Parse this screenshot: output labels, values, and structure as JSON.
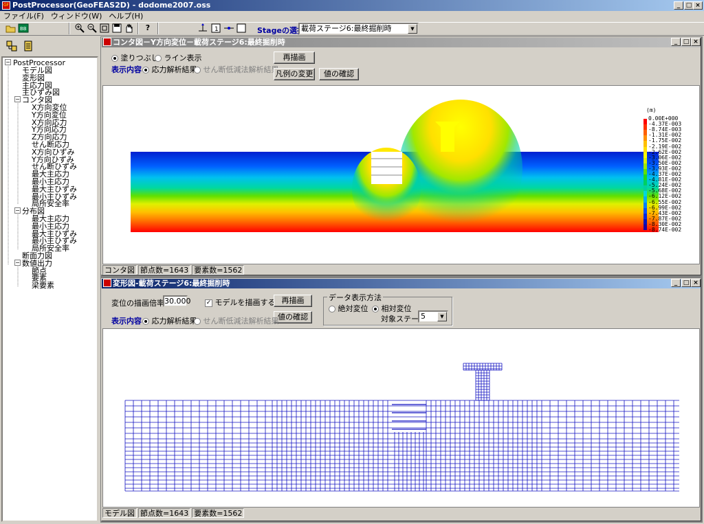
{
  "app": {
    "title": "PostProcessor(GeoFEAS2D) - dodome2007.oss",
    "min": "_",
    "max": "□",
    "close": "×"
  },
  "menu": [
    "ファイル(F)",
    "ウィンドウ(W)",
    "ヘルプ(H)"
  ],
  "toolbar": {
    "icons": [
      "open-icon",
      "export-icon",
      "zoom-in-icon",
      "zoom-out-icon",
      "fit-icon",
      "save-icon",
      "pan-icon",
      "help-icon",
      "axis-icon",
      "frame1-icon",
      "arrow-icon",
      "rect-icon"
    ],
    "help_glyph": "?",
    "stage_label": "Stageの選択",
    "stage_value": "載荷ステージ6:最終掘削時"
  },
  "tree": {
    "root": "PostProcessor",
    "items": [
      {
        "label": "モデル図",
        "level": 1
      },
      {
        "label": "変形図",
        "level": 1
      },
      {
        "label": "主応力図",
        "level": 1
      },
      {
        "label": "主ひずみ図",
        "level": 1
      },
      {
        "label": "コンタ図",
        "level": 1,
        "expanded": true
      },
      {
        "label": "X方向変位",
        "level": 2
      },
      {
        "label": "Y方向変位",
        "level": 2
      },
      {
        "label": "X方向応力",
        "level": 2
      },
      {
        "label": "Y方向応力",
        "level": 2
      },
      {
        "label": "Z方向応力",
        "level": 2
      },
      {
        "label": "せん断応力",
        "level": 2
      },
      {
        "label": "X方向ひずみ",
        "level": 2
      },
      {
        "label": "Y方向ひずみ",
        "level": 2
      },
      {
        "label": "せん断ひずみ",
        "level": 2
      },
      {
        "label": "最大主応力",
        "level": 2
      },
      {
        "label": "最小主応力",
        "level": 2
      },
      {
        "label": "最大主ひずみ",
        "level": 2
      },
      {
        "label": "最小主ひずみ",
        "level": 2
      },
      {
        "label": "局所安全率",
        "level": 2
      },
      {
        "label": "分布図",
        "level": 1,
        "expanded": true
      },
      {
        "label": "最大主応力",
        "level": 2
      },
      {
        "label": "最小主応力",
        "level": 2
      },
      {
        "label": "最大主ひずみ",
        "level": 2
      },
      {
        "label": "最小主ひずみ",
        "level": 2
      },
      {
        "label": "局所安全率",
        "level": 2
      },
      {
        "label": "断面力図",
        "level": 1
      },
      {
        "label": "数値出力",
        "level": 1,
        "expanded": true
      },
      {
        "label": "節点",
        "level": 2
      },
      {
        "label": "要素",
        "level": 2
      },
      {
        "label": "梁要素",
        "level": 2
      }
    ]
  },
  "contour_window": {
    "title": "コンタ図－Y方向変位－載荷ステージ6:最終掘削時",
    "fill_label": "塗りつぶし",
    "line_label": "ライン表示",
    "display_label": "表示内容",
    "result_label": "応力解析結果",
    "shear_label": "せん断低減法解析結果",
    "redraw": "再描画",
    "legend_change": "凡例の変更",
    "check_value": "値の確認",
    "unit": "(m)",
    "legend_values": [
      "0.00E+000",
      "-4.37E-003",
      "-8.74E-003",
      "-1.31E-002",
      "-1.75E-002",
      "-2.19E-002",
      "-2.62E-002",
      "-3.06E-002",
      "-3.50E-002",
      "-3.93E-002",
      "-4.37E-002",
      "-4.81E-002",
      "-5.24E-002",
      "-5.68E-002",
      "-6.12E-002",
      "-6.55E-002",
      "-6.99E-002",
      "-7.43E-002",
      "-7.87E-002",
      "-8.30E-002",
      "-8.74E-002"
    ],
    "legend_colors": [
      "#ff0000",
      "#ff3000",
      "#ff6000",
      "#ff9000",
      "#ffc000",
      "#ffe000",
      "#ffff00",
      "#d8f000",
      "#a0e800",
      "#60e000",
      "#20d820",
      "#00d060",
      "#00d0a0",
      "#00d8d8",
      "#00b0f0",
      "#0080ff",
      "#0050ff",
      "#0028e0",
      "#0010c0",
      "#2000a0"
    ],
    "status": [
      "コンタ図",
      "節点数=1643",
      "要素数=1562"
    ]
  },
  "deform_window": {
    "title": "変形図-載荷ステージ6:最終掘削時",
    "scale_label": "変位の描画倍率",
    "scale_value": "30.000",
    "draw_model": "モデルを描画する",
    "redraw": "再描画",
    "check_value": "値の確認",
    "display_label": "表示内容",
    "result_label": "応力解析結果",
    "shear_label": "せん断低減法解析結果",
    "group_title": "データ表示方法",
    "absolute": "絶対変位",
    "relative": "相対変位",
    "target_stage_label": "対象ステージ",
    "target_stage_value": "5",
    "status": [
      "モデル図",
      "節点数=1643",
      "要素数=1562"
    ]
  }
}
